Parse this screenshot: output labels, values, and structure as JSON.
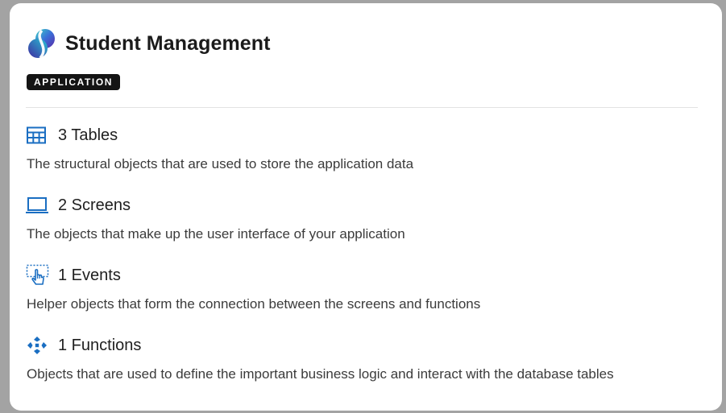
{
  "app": {
    "title": "Student Management",
    "badge": "APPLICATION",
    "logo_icon": "app-logo-icon"
  },
  "colors": {
    "accent": "#1a6ec2",
    "badge_bg": "#141414",
    "title_text": "#1b1b1b",
    "desc_text": "#3b3b3b"
  },
  "sections": [
    {
      "icon": "table-icon",
      "title": "3 Tables",
      "description": "The structural objects that are used to store the application data"
    },
    {
      "icon": "laptop-icon",
      "title": "2 Screens",
      "description": "The objects that make up the user interface of your application"
    },
    {
      "icon": "click-event-icon",
      "title": "1 Events",
      "description": "Helper objects that form the connection between the screens and functions"
    },
    {
      "icon": "function-icon",
      "title": "1 Functions",
      "description": "Objects that are used to define the important business logic and interact with the database tables"
    }
  ]
}
